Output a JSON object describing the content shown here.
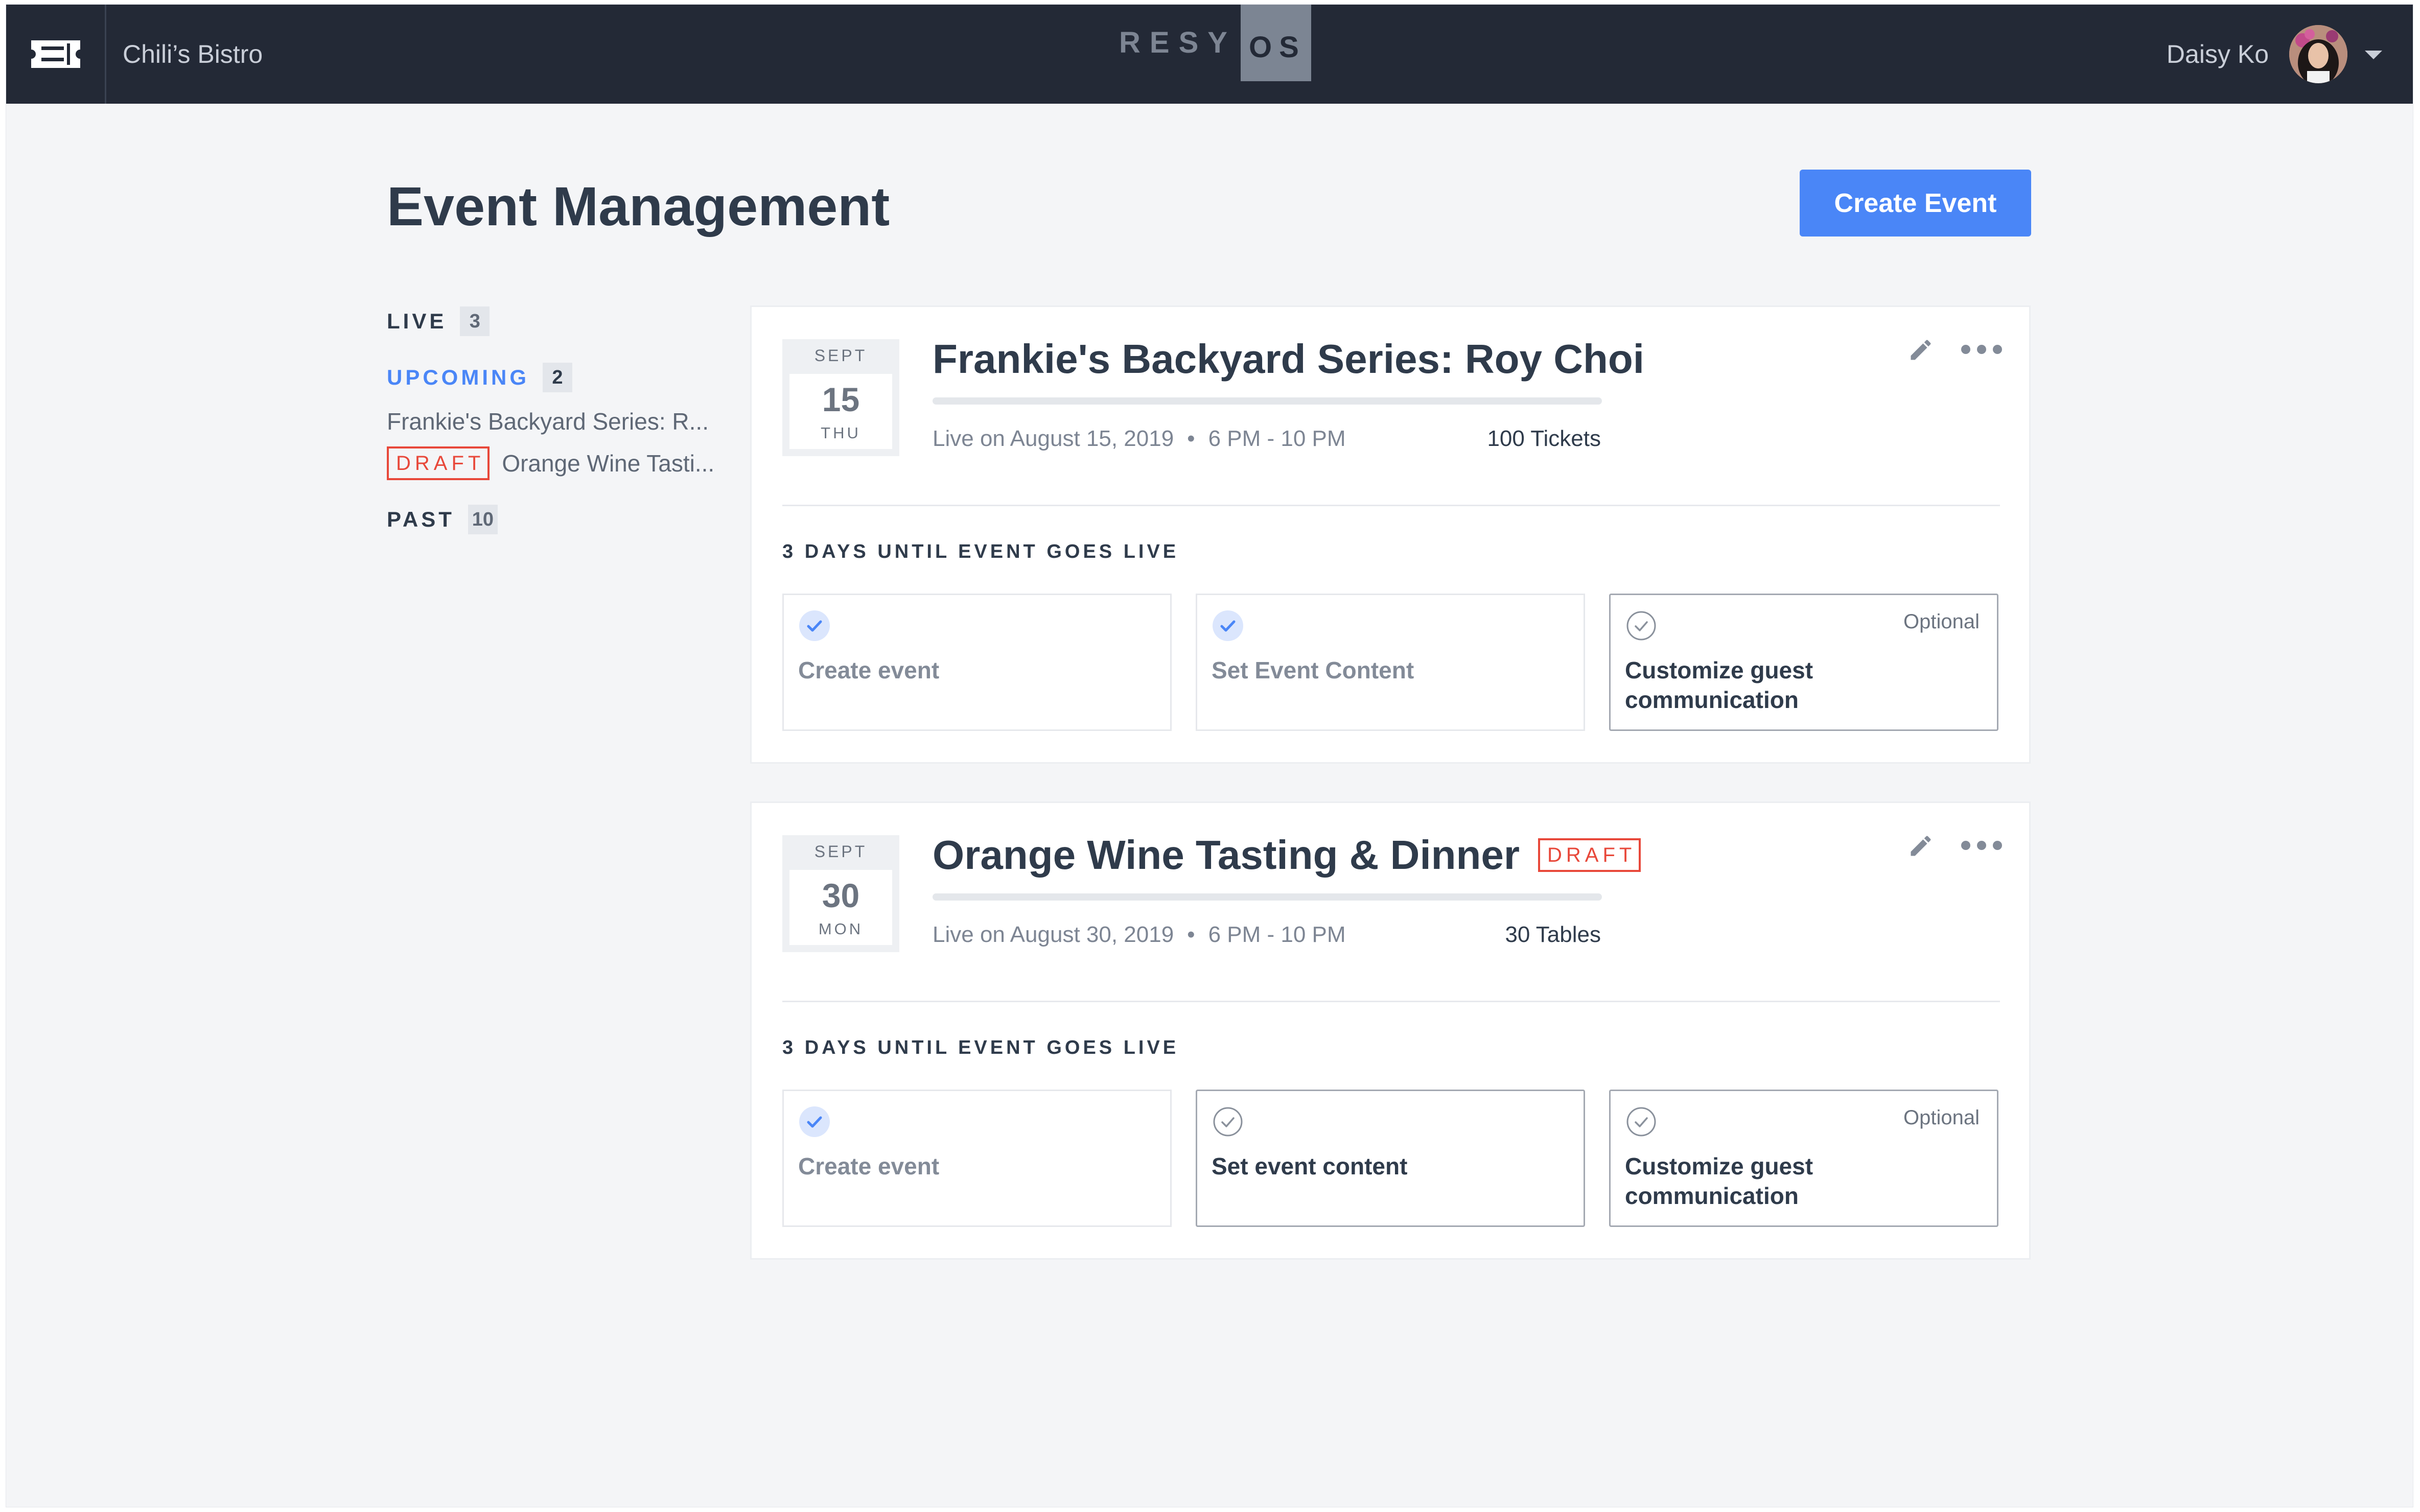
{
  "nav": {
    "venue": "Chili’s Bistro",
    "brand_resy": "RESY",
    "brand_os": "OS",
    "user_name": "Daisy Ko"
  },
  "page": {
    "title": "Event Management",
    "create_button": "Create Event"
  },
  "sidebar": {
    "live": {
      "label": "LIVE",
      "count": "3"
    },
    "upcoming": {
      "label": "UPCOMING",
      "count": "2",
      "items": [
        {
          "name": "Frankie's Backyard Series: R..."
        },
        {
          "badge": "DRAFT",
          "name": "Orange Wine Tasti..."
        }
      ]
    },
    "past": {
      "label": "PAST",
      "count": "10"
    }
  },
  "events": [
    {
      "month": "SEPT",
      "day": "15",
      "weekday": "THU",
      "title": "Frankie's Backyard Series: Roy Choi",
      "live_on": "Live on August 15, 2019",
      "time": "6 PM - 10 PM",
      "capacity": "100 Tickets",
      "countdown": "3 DAYS UNTIL EVENT GOES LIVE",
      "steps": [
        {
          "label": "Create event",
          "status": "done"
        },
        {
          "label": "Set Event Content",
          "status": "done"
        },
        {
          "label": "Customize guest communication",
          "status": "pending",
          "tag": "Optional"
        }
      ]
    },
    {
      "month": "SEPT",
      "day": "30",
      "weekday": "MON",
      "title": "Orange Wine Tasting & Dinner",
      "badge": "DRAFT",
      "live_on": "Live on August 30, 2019",
      "time": "6 PM - 10 PM",
      "capacity": "30 Tables",
      "countdown": "3 DAYS UNTIL EVENT GOES LIVE",
      "steps": [
        {
          "label": "Create event",
          "status": "done"
        },
        {
          "label": "Set event content",
          "status": "pending"
        },
        {
          "label": "Customize guest communication",
          "status": "pending",
          "tag": "Optional"
        }
      ]
    }
  ],
  "separator": "•",
  "colors": {
    "topbar": "#232936",
    "accent": "#4a86f7",
    "draft": "#e8483a",
    "background": "#f4f5f7"
  },
  "icons": [
    "ticket-logo-icon",
    "chevron-down-icon",
    "pencil-icon",
    "more-icon",
    "check-done-icon",
    "check-pending-icon"
  ]
}
